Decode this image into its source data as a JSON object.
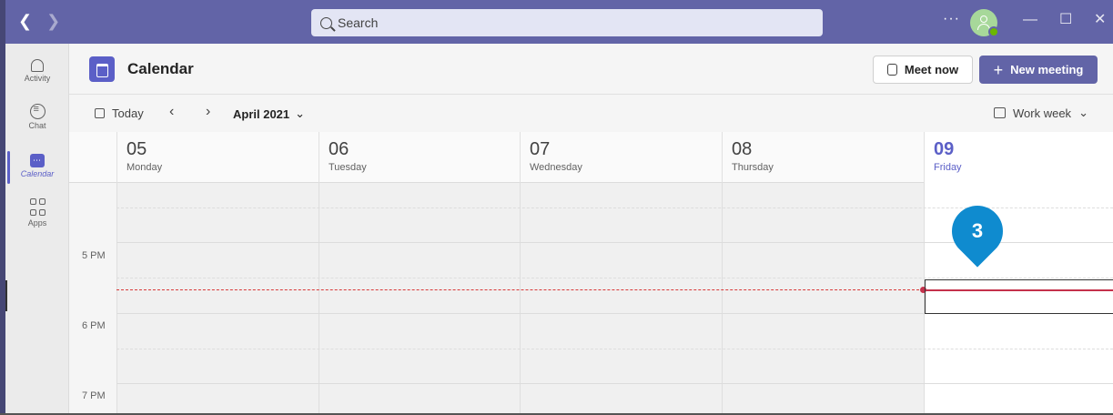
{
  "titlebar": {
    "search_placeholder": "Search",
    "more_label": "···",
    "minimize_label": "—",
    "maximize_label": "☐",
    "close_label": "✕"
  },
  "rail": {
    "items": [
      {
        "label": "Activity",
        "icon": "bell-icon"
      },
      {
        "label": "Chat",
        "icon": "chat-icon"
      },
      {
        "label": "Calendar",
        "icon": "calendar-icon",
        "active": true
      },
      {
        "label": "Apps",
        "icon": "apps-icon"
      }
    ]
  },
  "header": {
    "title": "Calendar",
    "meet_now_label": "Meet now",
    "new_meeting_label": "New meeting"
  },
  "toolbar": {
    "today_label": "Today",
    "prev_label": "‹",
    "next_label": "›",
    "month_label": "April 2021",
    "view_label": "Work week"
  },
  "grid": {
    "days": [
      {
        "num": "05",
        "name": "Monday"
      },
      {
        "num": "06",
        "name": "Tuesday"
      },
      {
        "num": "07",
        "name": "Wednesday"
      },
      {
        "num": "08",
        "name": "Thursday"
      },
      {
        "num": "09",
        "name": "Friday",
        "today": true
      }
    ],
    "time_labels": [
      "5 PM",
      "6 PM",
      "7 PM"
    ]
  },
  "marker": {
    "label": "3"
  },
  "colors": {
    "titlebar": "#6264a7",
    "accent": "#5b5fc7",
    "now_line": "#c4314b",
    "marker": "#0f8bcf"
  }
}
